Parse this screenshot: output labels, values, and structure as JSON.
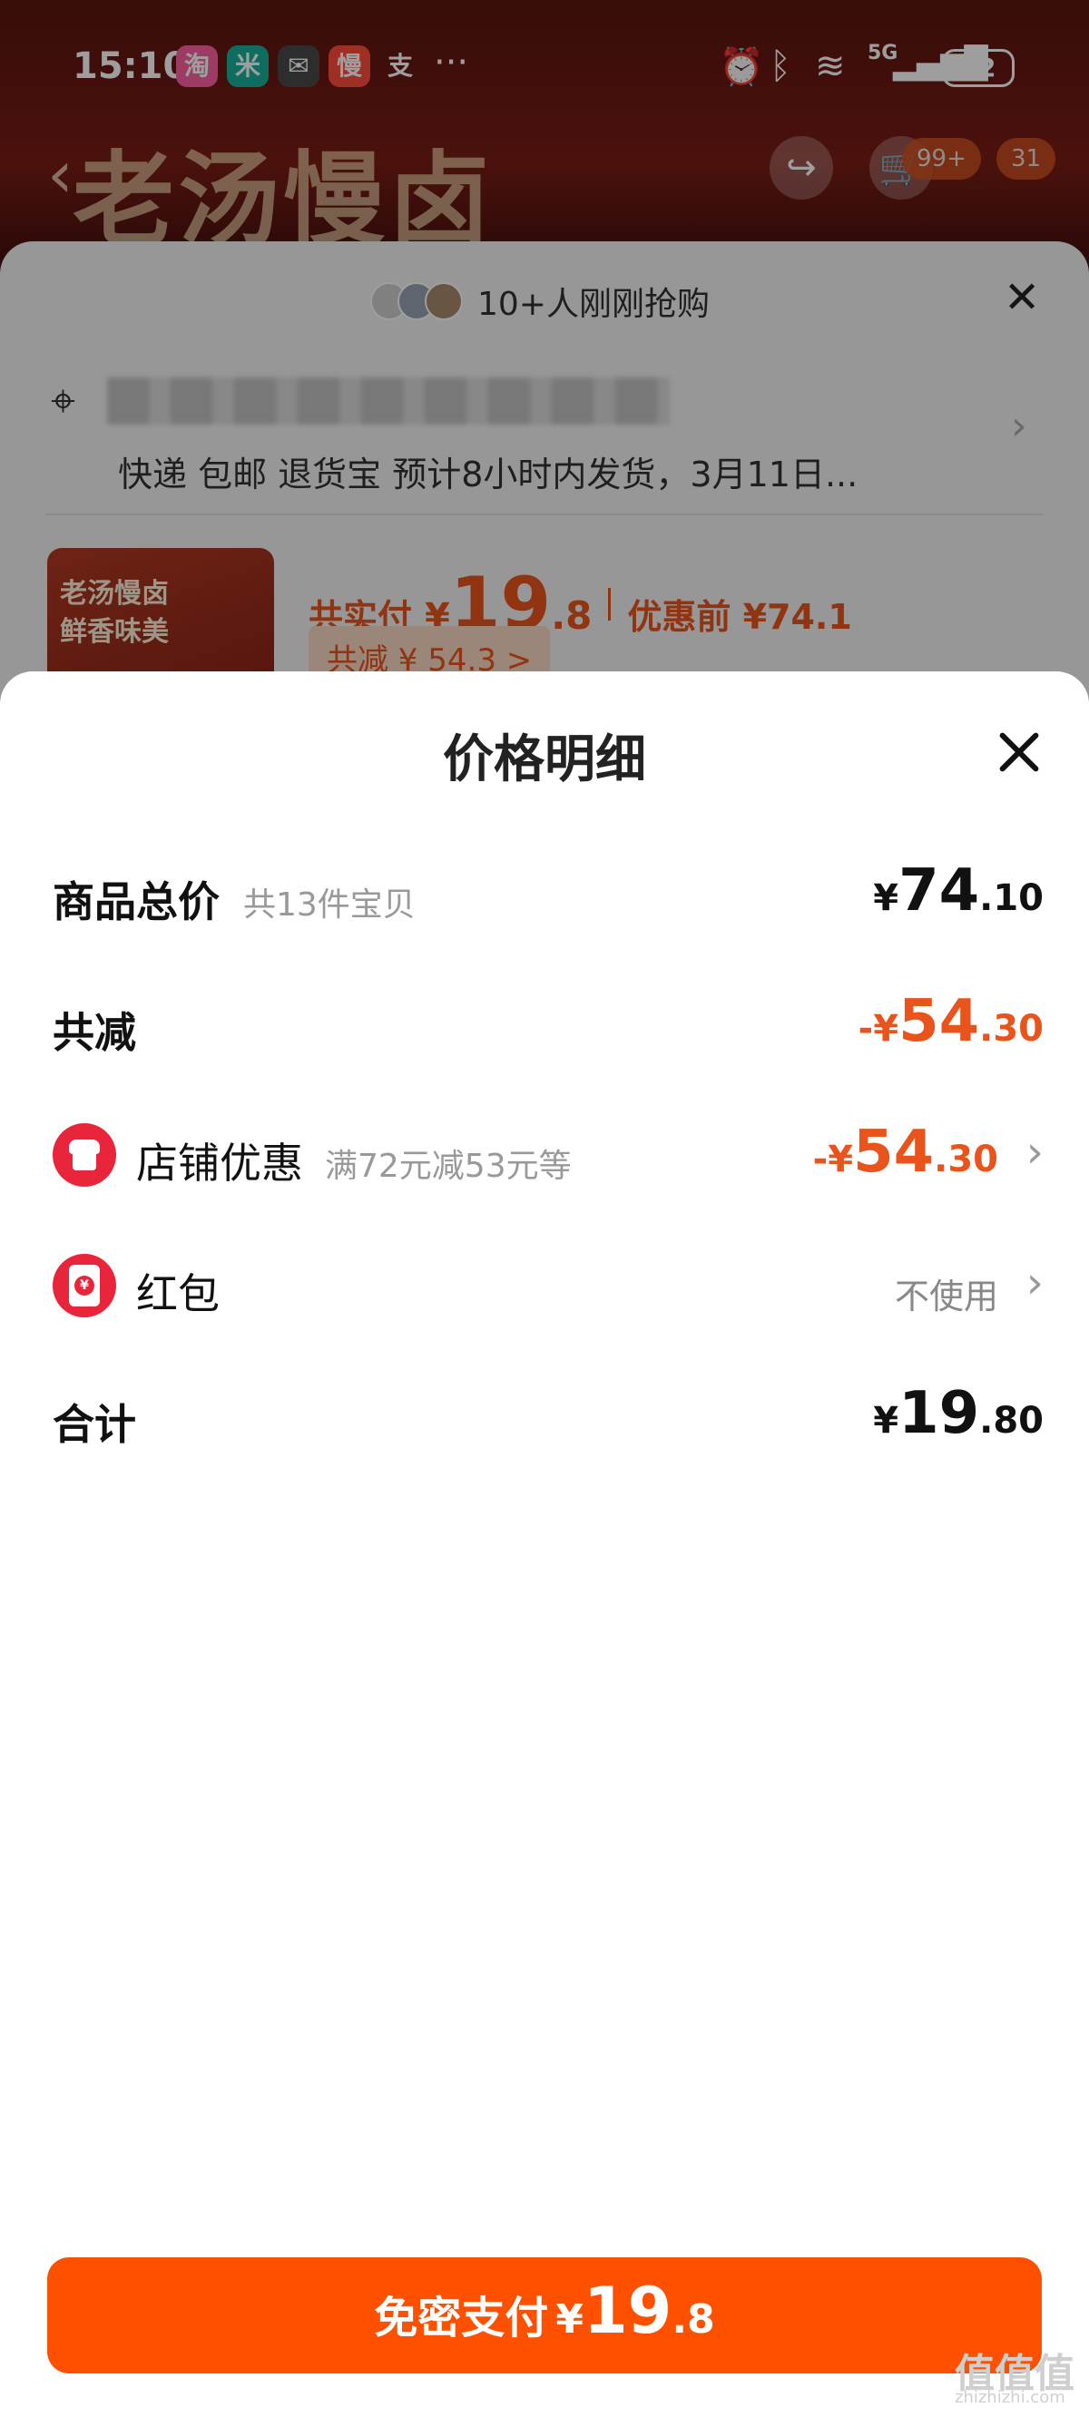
{
  "status_bar": {
    "time": "15:10",
    "apps": [
      {
        "icon": "taobao-icon",
        "glyph": "淘",
        "color": "#ff5fa2"
      },
      {
        "icon": "mijia-icon",
        "glyph": "米",
        "color": "#19b09a"
      },
      {
        "icon": "wechat-icon",
        "glyph": "✉",
        "color": "#444444"
      },
      {
        "icon": "manman-icon",
        "glyph": "慢",
        "color": "#ff4d3a"
      },
      {
        "icon": "alipay-icon",
        "glyph": "支",
        "color": "#333333"
      }
    ],
    "more": "···",
    "network": "5G",
    "battery": "42"
  },
  "background_page": {
    "hero_title": "老汤慢卤",
    "cart_badge": "99+",
    "msg_badge": "31"
  },
  "order_sheet": {
    "recent_buyers": "10+人刚刚抢购",
    "shipping": "快递 包邮 退货宝 预计8小时内发货，3月11日...",
    "thumb_text_line1": "老汤慢卤",
    "thumb_text_line2": "鲜香味美",
    "paid_label": "共实付",
    "paid_currency": "¥",
    "paid_int": "19",
    "paid_dec": ".8",
    "before_label": "优惠前 ¥74.1",
    "saved_label": "共减 ¥ 54.3 >"
  },
  "price_detail": {
    "title": "价格明细",
    "rows": {
      "total": {
        "label": "商品总价",
        "sub": "共13件宝贝",
        "currency": "¥",
        "int": "74",
        "dec": ".10"
      },
      "reduction": {
        "label": "共减",
        "currency": "-¥",
        "int": "54",
        "dec": ".30"
      },
      "store": {
        "label": "店铺优惠",
        "sub": "满72元减53元等",
        "currency": "-¥",
        "int": "54",
        "dec": ".30"
      },
      "red_packet": {
        "label": "红包",
        "status": "不使用"
      },
      "sum": {
        "label": "合计",
        "currency": "¥",
        "int": "19",
        "dec": ".80"
      }
    },
    "pay_button": {
      "label": "免密支付",
      "currency": "¥",
      "int": "19",
      "dec": ".8"
    }
  },
  "watermark": {
    "brand": "值值值",
    "url": "zhizhizhi.com"
  },
  "colors": {
    "accent": "#ff5000",
    "discount": "#e8541c",
    "icon_red": "#e8253a"
  }
}
